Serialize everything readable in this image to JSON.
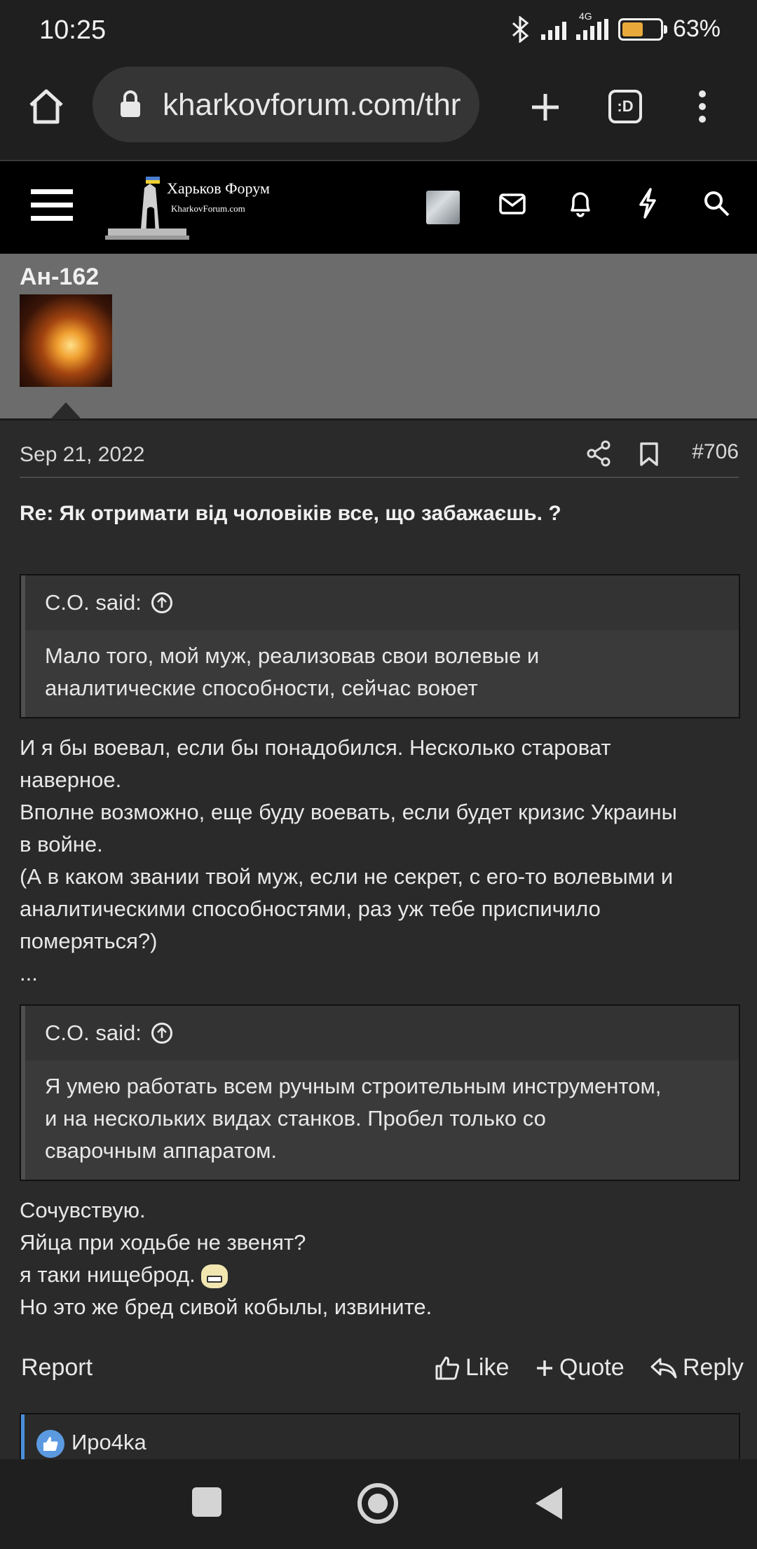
{
  "status": {
    "time": "10:25",
    "network": "4G",
    "battery": "63%",
    "battery_level": 0.63
  },
  "browser": {
    "url": "kharkovforum.com/thr"
  },
  "site": {
    "logo_title": "Харьков Форум",
    "logo_subtitle": "KharkovForum.com"
  },
  "post": {
    "author": "Ан-162",
    "date": "Sep 21, 2022",
    "number": "#706",
    "title": "Re: Як отримати від чоловіків все, що забажаєшь. ?",
    "quote1": {
      "author": "C.O. said:",
      "lines": [
        "Мало того, мой муж, реализовав свои волевые и",
        "аналитические способности, сейчас воюет"
      ]
    },
    "body1": [
      "И я бы воевал, если бы понадобился. Несколько староват",
      "наверное.",
      "Вполне возможно, еще буду воевать, если будет кризис Украины",
      "в войне.",
      "(А в каком звании твой муж, если не секрет, с его-то волевыми и",
      "аналитическими способностями, раз уж тебе приспичило",
      "померяться?)",
      "..."
    ],
    "quote2": {
      "author": "C.O. said:",
      "lines": [
        "Я умею работать всем ручным строительным инструментом,",
        "и на нескольких видах станков. Пробел только со",
        "сварочным аппаратом."
      ]
    },
    "body2": [
      "Сочувствую.",
      "Яйца при ходьбе не звенят?",
      "я таки нищеброд.",
      "Но это же бред сивой кобылы, извините."
    ]
  },
  "actions": {
    "report": "Report",
    "like": "Like",
    "quote": "Quote",
    "reply": "Reply"
  },
  "reactions": {
    "user": "Иро4ka"
  }
}
